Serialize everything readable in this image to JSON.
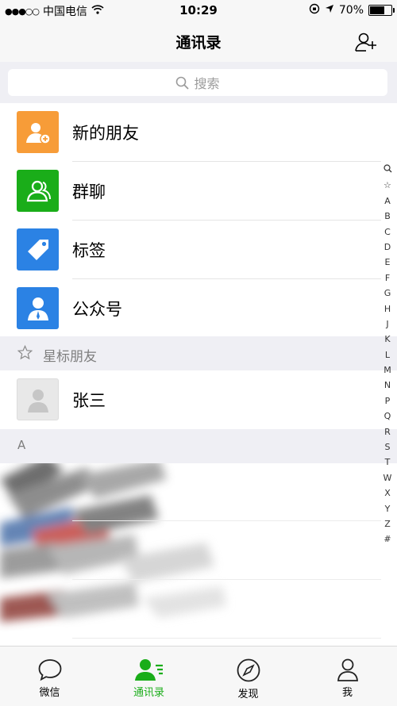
{
  "status_bar": {
    "signal": "●●●○○",
    "carrier": "中国电信",
    "time": "10:29",
    "battery_percent": "70%",
    "battery_level": 0.7
  },
  "nav": {
    "title": "通讯录"
  },
  "search": {
    "placeholder": "搜索"
  },
  "function_rows": [
    {
      "label": "新的朋友",
      "icon": "new-friend-icon",
      "color": "#f79c38"
    },
    {
      "label": "群聊",
      "icon": "group-chat-icon",
      "color": "#1aad19"
    },
    {
      "label": "标签",
      "icon": "tag-icon",
      "color": "#2b82e4"
    },
    {
      "label": "公众号",
      "icon": "official-account-icon",
      "color": "#2b82e4"
    }
  ],
  "starred_section": {
    "label": "星标朋友"
  },
  "starred_contacts": [
    {
      "name": "张三"
    }
  ],
  "letter_section": {
    "label": "A"
  },
  "index_letters": [
    "☆",
    "A",
    "B",
    "C",
    "D",
    "E",
    "F",
    "G",
    "H",
    "J",
    "K",
    "L",
    "M",
    "N",
    "P",
    "Q",
    "R",
    "S",
    "T",
    "W",
    "X",
    "Y",
    "Z",
    "#"
  ],
  "tabs": [
    {
      "label": "微信",
      "icon": "chat-bubble-icon",
      "active": false
    },
    {
      "label": "通讯录",
      "icon": "contacts-icon",
      "active": true
    },
    {
      "label": "发现",
      "icon": "compass-icon",
      "active": false
    },
    {
      "label": "我",
      "icon": "person-icon",
      "active": false
    }
  ],
  "colors": {
    "accent": "#1aad19",
    "background": "#efeff4"
  }
}
